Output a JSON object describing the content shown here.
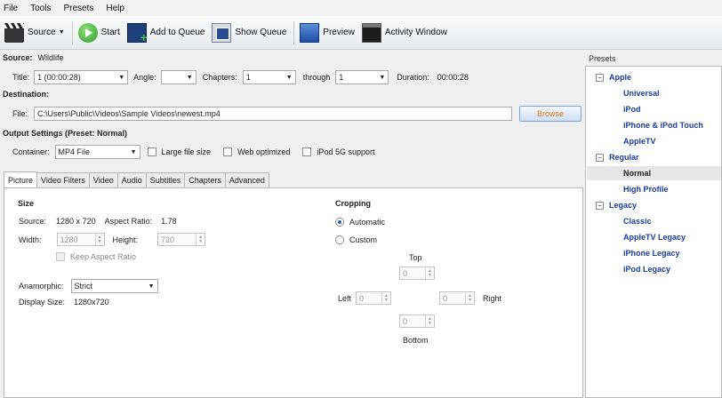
{
  "menu": {
    "items": [
      "File",
      "Tools",
      "Presets",
      "Help"
    ]
  },
  "toolbar": {
    "source": "Source",
    "start": "Start",
    "add_to_queue": "Add to Queue",
    "show_queue": "Show Queue",
    "preview": "Preview",
    "activity_window": "Activity Window"
  },
  "source": {
    "label": "Source:",
    "name": "Wildlife",
    "title_label": "Title:",
    "title_value": "1 (00:00:28)",
    "angle_label": "Angle:",
    "angle_value": "",
    "chapters_label": "Chapters:",
    "chapters_from": "1",
    "through_label": "through",
    "chapters_to": "1",
    "duration_label": "Duration:",
    "duration_value": "00:00:28"
  },
  "destination": {
    "label": "Destination:",
    "file_label": "File:",
    "file_path": "C:\\Users\\Public\\Videos\\Sample Videos\\newest.mp4",
    "browse": "Browse"
  },
  "output": {
    "label": "Output Settings (Preset: Normal)",
    "container_label": "Container:",
    "container_value": "MP4 File",
    "large_file": "Large file size",
    "web_optimized": "Web optimized",
    "ipod_5g": "iPod 5G support"
  },
  "tabs": [
    "Picture",
    "Video Filters",
    "Video",
    "Audio",
    "Subtitles",
    "Chapters",
    "Advanced"
  ],
  "picture": {
    "size_heading": "Size",
    "source_label": "Source:",
    "source_value": "1280 x 720",
    "aspect_label": "Aspect Ratio:",
    "aspect_value": "1.78",
    "width_label": "Width:",
    "width_value": "1280",
    "height_label": "Height:",
    "height_value": "720",
    "keep_aspect": "Keep Aspect Ratio",
    "anamorphic_label": "Anamorphic:",
    "anamorphic_value": "Strict",
    "display_size_label": "Display Size:",
    "display_size_value": "1280x720",
    "cropping_heading": "Cropping",
    "automatic": "Automatic",
    "custom": "Custom",
    "top_label": "Top",
    "left_label": "Left",
    "right_label": "Right",
    "bottom_label": "Bottom",
    "crop_top": "0",
    "crop_left": "0",
    "crop_right": "0",
    "crop_bottom": "0"
  },
  "presets": {
    "header": "Presets",
    "groups": [
      {
        "name": "Apple",
        "items": [
          "Universal",
          "iPod",
          "iPhone & iPod Touch",
          "AppleTV"
        ]
      },
      {
        "name": "Regular",
        "items": [
          "Normal",
          "High Profile"
        ]
      },
      {
        "name": "Legacy",
        "items": [
          "Classic",
          "AppleTV Legacy",
          "iPhone Legacy",
          "iPod Legacy"
        ]
      }
    ],
    "selected": "Normal"
  }
}
